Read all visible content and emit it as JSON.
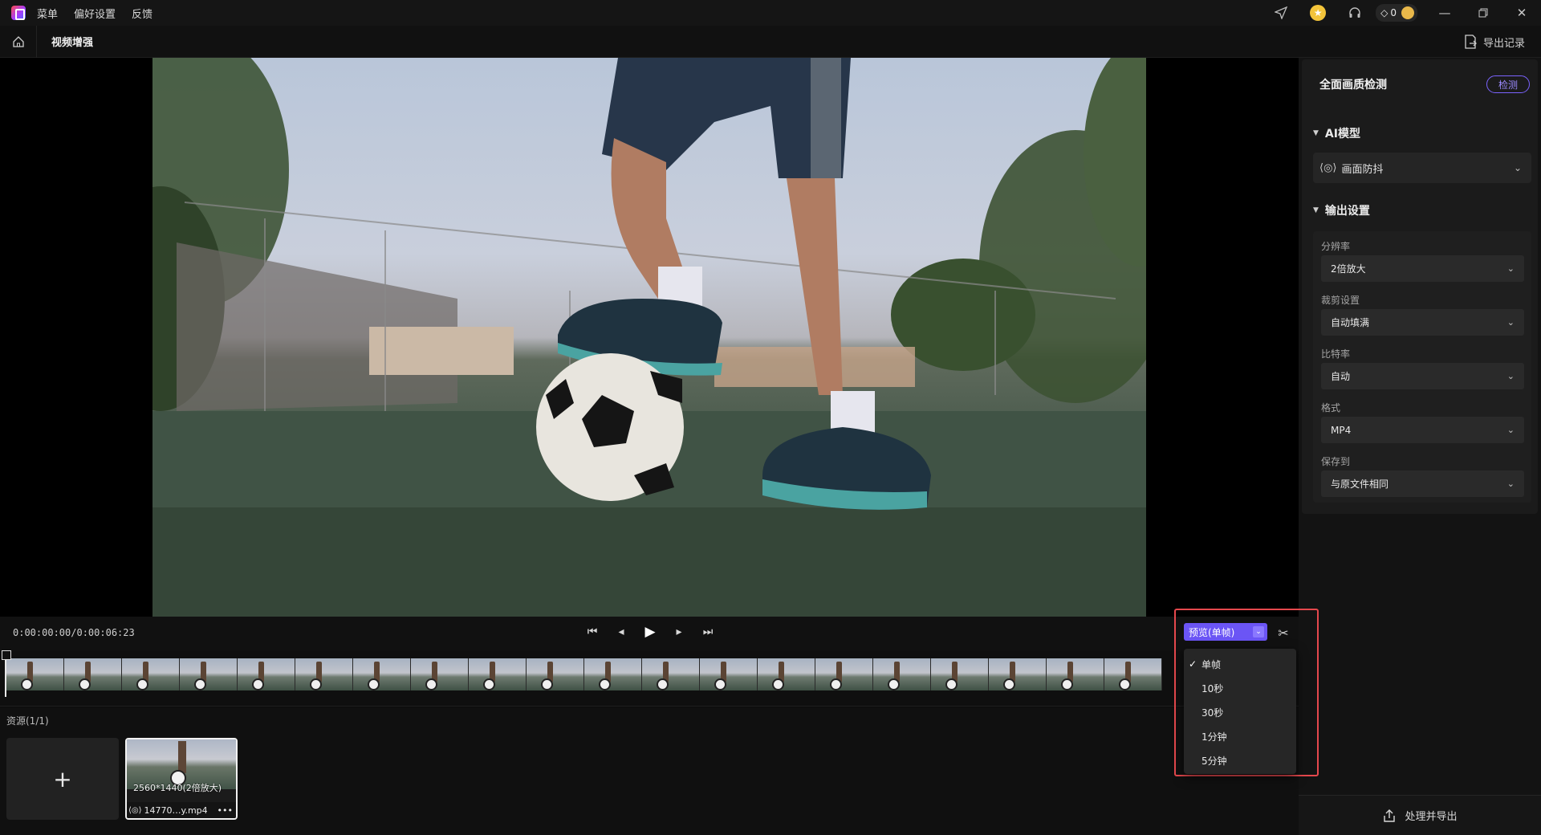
{
  "menu": {
    "items": [
      "菜单",
      "偏好设置",
      "反馈"
    ]
  },
  "titlebar": {
    "gem_count": "0"
  },
  "subbar": {
    "page_title": "视频增强",
    "export_history_label": "导出记录"
  },
  "panel": {
    "quality_check_title": "全面画质检测",
    "detect_button": "检测",
    "ai_model_section": "AI模型",
    "ai_model_value": "画面防抖",
    "output_section": "输出设置",
    "fields": [
      {
        "label": "分辨率",
        "value": "2倍放大"
      },
      {
        "label": "裁剪设置",
        "value": "自动填满"
      },
      {
        "label": "比特率",
        "value": "自动"
      },
      {
        "label": "格式",
        "value": "MP4"
      },
      {
        "label": "保存到",
        "value": "与原文件相同"
      }
    ],
    "process_button": "处理并导出"
  },
  "player": {
    "timecode": "0:00:00:00/0:00:06:23"
  },
  "preview": {
    "selected_label": "预览(单帧)",
    "options": [
      "单帧",
      "10秒",
      "30秒",
      "1分钟",
      "5分钟"
    ],
    "selected_option": "单帧"
  },
  "assets": {
    "label": "资源(1/1)",
    "add_symbol": "+",
    "item": {
      "resolution": "2560*1440(2倍放大)",
      "name": "14770…y.mp4"
    }
  },
  "colors": {
    "accent": "#6b55f5",
    "highlight_border": "#e5484d"
  }
}
